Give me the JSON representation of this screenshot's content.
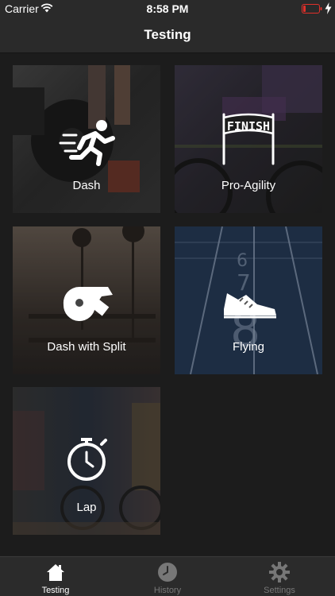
{
  "status_bar": {
    "carrier": "Carrier",
    "time": "8:58 PM",
    "icons": [
      "wifi-icon",
      "battery-low-icon",
      "charging-bolt-icon"
    ]
  },
  "nav": {
    "title": "Testing"
  },
  "tiles": [
    {
      "label": "Dash",
      "icon": "sprinter-icon"
    },
    {
      "label": "Pro-Agility",
      "icon": "finish-line-icon",
      "icon_text": "FINISH"
    },
    {
      "label": "Dash with Split",
      "icon": "whistle-icon"
    },
    {
      "label": "Flying",
      "icon": "running-shoe-icon"
    },
    {
      "label": "Lap",
      "icon": "stopwatch-icon"
    }
  ],
  "tab_bar": {
    "tabs": [
      {
        "label": "Testing",
        "icon": "home-icon",
        "active": true
      },
      {
        "label": "History",
        "icon": "clock-icon",
        "active": false
      },
      {
        "label": "Settings",
        "icon": "gear-icon",
        "active": false
      }
    ]
  },
  "colors": {
    "background": "#1f1f1f",
    "bar": "#2a2a2a",
    "battery_low": "#e0302a",
    "active_tab": "#ffffff",
    "inactive_tab": "#777777"
  }
}
